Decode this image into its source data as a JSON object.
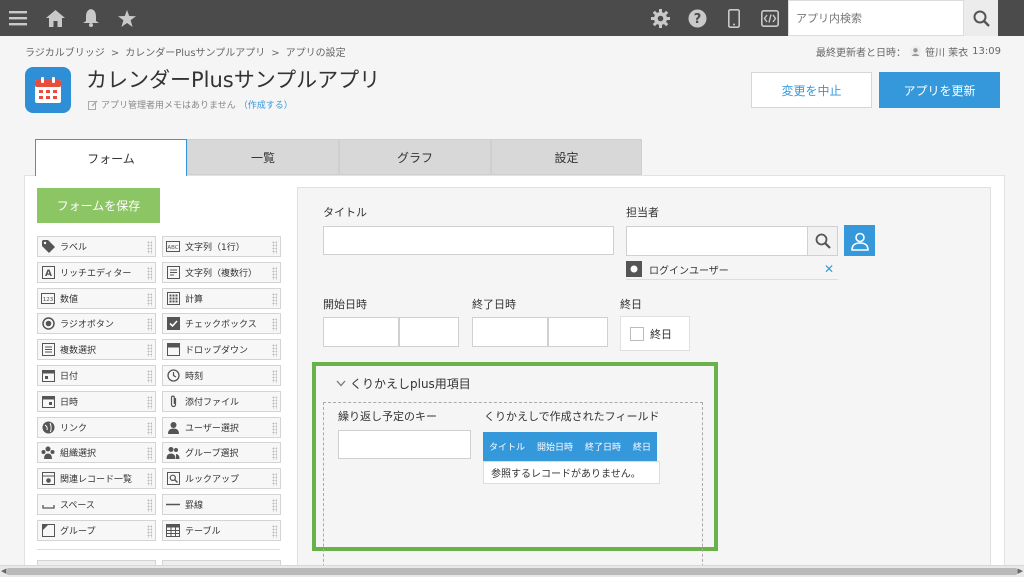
{
  "topbar": {
    "icons": [
      "menu-icon",
      "home-icon",
      "bell-icon",
      "star-icon",
      "gear-icon",
      "help-icon",
      "mobile-icon",
      "code-icon"
    ],
    "search_placeholder": "アプリ内検索"
  },
  "breadcrumb": [
    "ラジカルブリッジ",
    "カレンダーPlusサンプルアプリ",
    "アプリの設定"
  ],
  "breadcrumb_sep": ">",
  "updater": {
    "label": "最終更新者と日時：",
    "user": "笹川 茉衣",
    "time": "13:09"
  },
  "app": {
    "title": "カレンダーPlusサンプルアプリ",
    "memo": "アプリ管理者用メモはありません",
    "memo_link": "（作成する）"
  },
  "buttons": {
    "cancel": "変更を中止",
    "update": "アプリを更新",
    "save_form": "フォームを保存"
  },
  "tabs": [
    "フォーム",
    "一覧",
    "グラフ",
    "設定"
  ],
  "palette": [
    [
      "ラベル",
      "文字列（1行）"
    ],
    [
      "リッチエディター",
      "文字列（複数行）"
    ],
    [
      "数値",
      "計算"
    ],
    [
      "ラジオボタン",
      "チェックボックス"
    ],
    [
      "複数選択",
      "ドロップダウン"
    ],
    [
      "日付",
      "時刻"
    ],
    [
      "日時",
      "添付ファイル"
    ],
    [
      "リンク",
      "ユーザー選択"
    ],
    [
      "組織選択",
      "グループ選択"
    ],
    [
      "関連レコード一覧",
      "ルックアップ"
    ],
    [
      "スペース",
      "罫線"
    ],
    [
      "グループ",
      "テーブル"
    ]
  ],
  "palette_icons": [
    [
      "tag-icon",
      "text-icon"
    ],
    [
      "rich-editor-icon",
      "multiline-text-icon"
    ],
    [
      "number-icon",
      "calculator-icon"
    ],
    [
      "radio-icon",
      "checkbox-icon"
    ],
    [
      "multi-select-icon",
      "dropdown-icon"
    ],
    [
      "calendar-icon",
      "clock-icon"
    ],
    [
      "datetime-icon",
      "paperclip-icon"
    ],
    [
      "globe-icon",
      "user-icon"
    ],
    [
      "org-icon",
      "group-icon"
    ],
    [
      "related-records-icon",
      "lookup-icon"
    ],
    [
      "space-icon",
      "border-line-icon"
    ],
    [
      "group-field-icon",
      "table-icon"
    ]
  ],
  "form": {
    "title_label": "タイトル",
    "assignee_label": "担当者",
    "login_user": "ログインユーザー",
    "start_label": "開始日時",
    "end_label": "終了日時",
    "allday_label": "終日",
    "allday_check": "終日",
    "group_title": "くりかえしplus用項目",
    "repeat_key_label": "繰り返し予定のキー",
    "created_fields_label": "くりかえしで作成されたフィールド",
    "table_headers": [
      "タイトル",
      "開始日時",
      "終了日時",
      "終日"
    ],
    "table_empty": "参照するレコードがありません。"
  },
  "colors": {
    "accent": "#3498db",
    "green": "#8cc563",
    "group_border": "#6ab14a",
    "topbar": "#4b4b4b"
  }
}
